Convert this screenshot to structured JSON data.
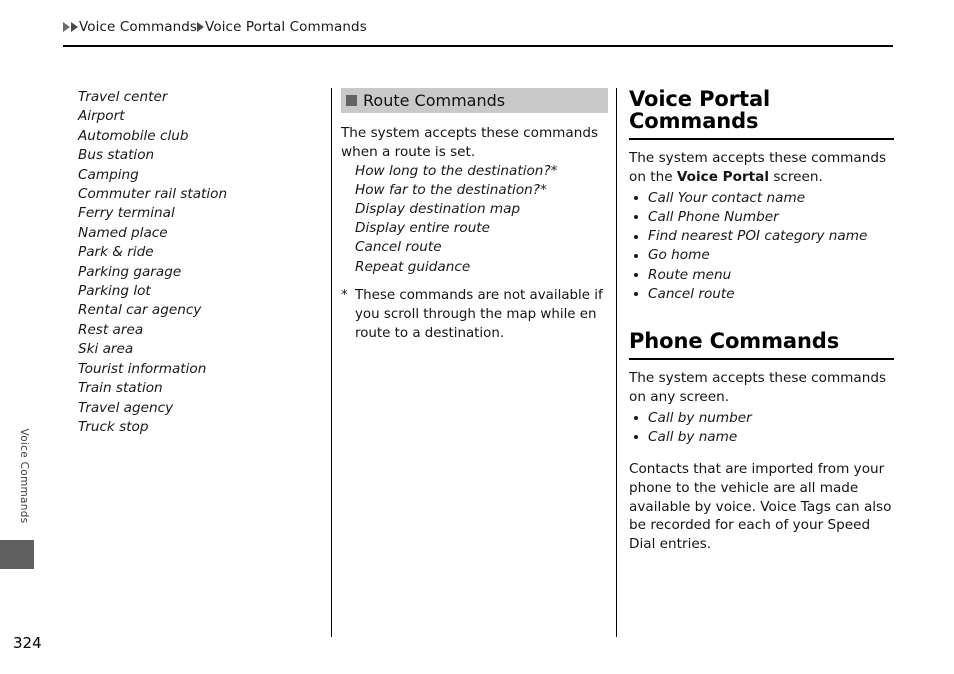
{
  "breadcrumb": {
    "arrow_icon": "triangle-right",
    "level1": "Voice Commands",
    "level2": "Voice Portal Commands"
  },
  "side_tab": {
    "label": "Voice Commands"
  },
  "page_number": "324",
  "columns": {
    "left": {
      "continued_list": [
        "Travel center",
        "Airport",
        "Automobile club",
        "Bus station",
        "Camping",
        "Commuter rail station",
        "Ferry terminal",
        "Named place",
        "Park & ride",
        "Parking garage",
        "Parking lot",
        "Rental car agency",
        "Rest area",
        "Ski area",
        "Tourist information",
        "Train station",
        "Travel agency",
        "Truck stop"
      ]
    },
    "middle": {
      "section_heading": "Route Commands",
      "section_bullet_icon": "filled-square",
      "intro": "The system accepts these commands when a route is set.",
      "commands": [
        "How long to the destination?*",
        "How far to the destination?*",
        "Display destination map",
        "Display entire route",
        "Cancel route",
        "Repeat guidance"
      ],
      "footnote_marker": "*",
      "footnote_text": "These commands are not available if you scroll through the map while en route to a destination."
    },
    "right": {
      "section1": {
        "heading": "Voice Portal Commands",
        "intro_part1": "The system accepts these commands on the ",
        "intro_bold": "Voice Portal",
        "intro_part2": " screen.",
        "commands": [
          "Call Your contact name",
          "Call Phone Number",
          "Find nearest POI category name",
          "Go home",
          "Route menu",
          "Cancel route"
        ]
      },
      "section2": {
        "heading": "Phone Commands",
        "intro": "The system accepts these commands on any screen.",
        "commands": [
          "Call by number",
          "Call by name"
        ],
        "note": "Contacts that are imported from your phone to the vehicle are all made available by voice. Voice Tags can also be recorded for each of your Speed Dial entries."
      }
    }
  },
  "colors": {
    "heading_bar": "#c9c9c9",
    "heading_square": "#636363",
    "side_tab": "#606060",
    "rule": "#000000"
  }
}
